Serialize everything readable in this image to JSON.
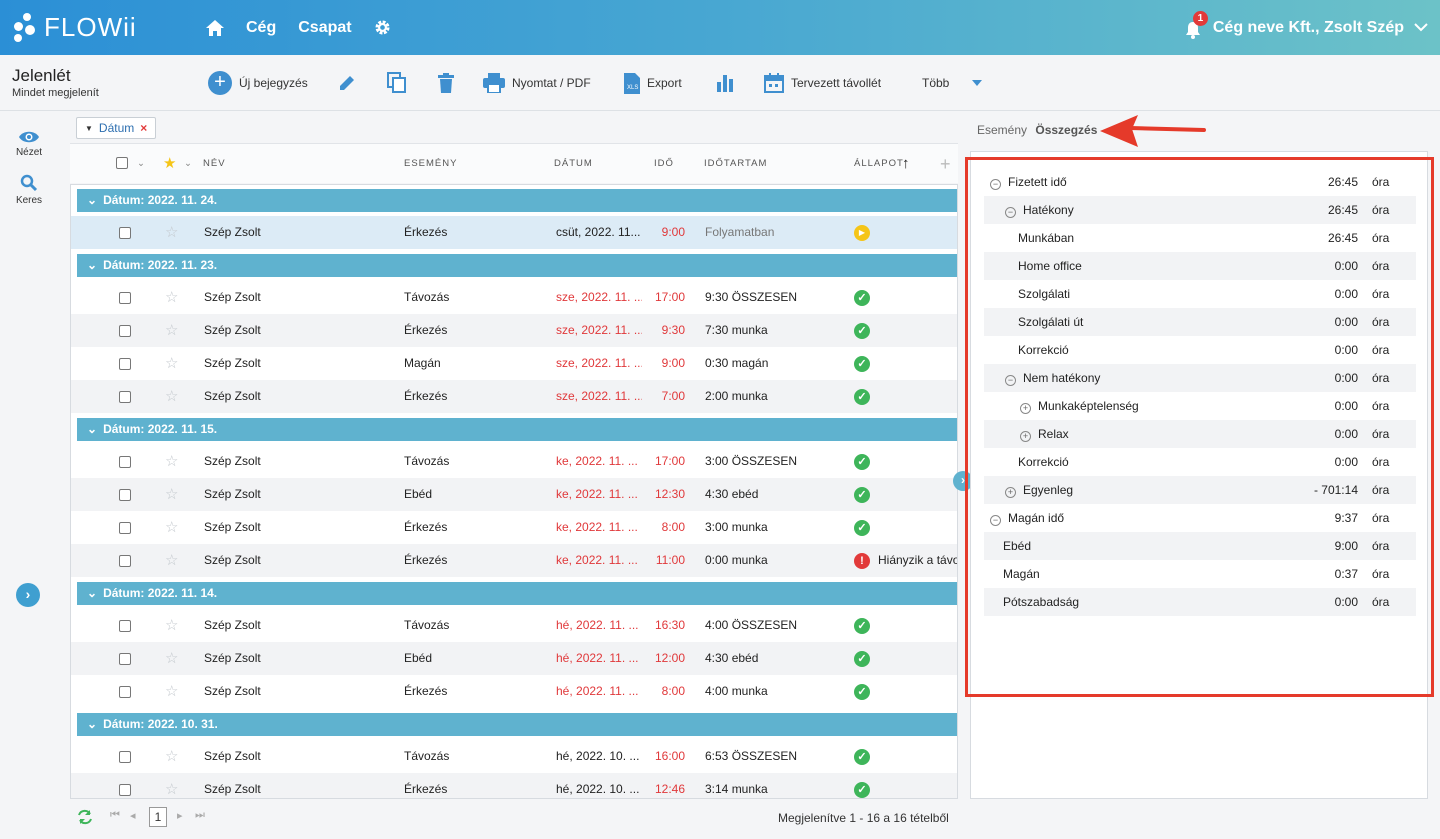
{
  "app": {
    "brand": "FLOWii",
    "nav": [
      "Cég",
      "Csapat"
    ],
    "notifications": "1",
    "account": "Cég neve Kft., Zsolt Szép"
  },
  "page": {
    "title": "Jelenlét",
    "subtitle": "Mindet megjelenít"
  },
  "toolbar": {
    "new_entry": "Új bejegyzés",
    "print": "Nyomtat / PDF",
    "export": "Export",
    "planned_absence": "Tervezett távollét",
    "more": "Több"
  },
  "sidebar": {
    "view": "Nézet",
    "search": "Keres"
  },
  "filter": {
    "chip": "Dátum"
  },
  "grid": {
    "columns": [
      "NÉV",
      "ESEMÉNY",
      "DÁTUM",
      "IDŐ",
      "IDŐTARTAM",
      "ÁLLAPOT"
    ],
    "groups": [
      {
        "label": "Dátum: 2022. 11. 24.",
        "rows": [
          {
            "name": "Szép Zsolt",
            "event": "Érkezés",
            "date": "csüt, 2022. 11...",
            "time": "9:00",
            "duration": "Folyamatban",
            "status": "in-progress",
            "date_red": false,
            "selected": true
          }
        ]
      },
      {
        "label": "Dátum: 2022. 11. 23.",
        "rows": [
          {
            "name": "Szép Zsolt",
            "event": "Távozás",
            "date": "sze, 2022. 11. ...",
            "time": "17:00",
            "duration": "9:30 ÖSSZESEN",
            "status": "ok",
            "date_red": true
          },
          {
            "name": "Szép Zsolt",
            "event": "Érkezés",
            "date": "sze, 2022. 11. ...",
            "time": "9:30",
            "duration": "7:30 munka",
            "status": "ok",
            "date_red": true
          },
          {
            "name": "Szép Zsolt",
            "event": "Magán",
            "date": "sze, 2022. 11. ...",
            "time": "9:00",
            "duration": "0:30 magán",
            "status": "ok",
            "date_red": true
          },
          {
            "name": "Szép Zsolt",
            "event": "Érkezés",
            "date": "sze, 2022. 11. ...",
            "time": "7:00",
            "duration": "2:00 munka",
            "status": "ok",
            "date_red": true
          }
        ]
      },
      {
        "label": "Dátum: 2022. 11. 15.",
        "rows": [
          {
            "name": "Szép Zsolt",
            "event": "Távozás",
            "date": "ke, 2022. 11. ...",
            "time": "17:00",
            "duration": "3:00 ÖSSZESEN",
            "status": "ok",
            "date_red": true
          },
          {
            "name": "Szép Zsolt",
            "event": "Ebéd",
            "date": "ke, 2022. 11. ...",
            "time": "12:30",
            "duration": "4:30 ebéd",
            "status": "ok",
            "date_red": true
          },
          {
            "name": "Szép Zsolt",
            "event": "Érkezés",
            "date": "ke, 2022. 11. ...",
            "time": "8:00",
            "duration": "3:00 munka",
            "status": "ok",
            "date_red": true
          },
          {
            "name": "Szép Zsolt",
            "event": "Érkezés",
            "date": "ke, 2022. 11. ...",
            "time": "11:00",
            "duration": "0:00 munka",
            "status": "error",
            "status_text": "Hiányzik a távo",
            "date_red": true
          }
        ]
      },
      {
        "label": "Dátum: 2022. 11. 14.",
        "rows": [
          {
            "name": "Szép Zsolt",
            "event": "Távozás",
            "date": "hé, 2022. 11. ...",
            "time": "16:30",
            "duration": "4:00 ÖSSZESEN",
            "status": "ok",
            "date_red": true
          },
          {
            "name": "Szép Zsolt",
            "event": "Ebéd",
            "date": "hé, 2022. 11. ...",
            "time": "12:00",
            "duration": "4:30 ebéd",
            "status": "ok",
            "date_red": true
          },
          {
            "name": "Szép Zsolt",
            "event": "Érkezés",
            "date": "hé, 2022. 11. ...",
            "time": "8:00",
            "duration": "4:00 munka",
            "status": "ok",
            "date_red": true
          }
        ]
      },
      {
        "label": "Dátum: 2022. 10. 31.",
        "rows": [
          {
            "name": "Szép Zsolt",
            "event": "Távozás",
            "date": "hé, 2022. 10. ...",
            "time": "16:00",
            "duration": "6:53 ÖSSZESEN",
            "status": "ok",
            "date_red": false
          },
          {
            "name": "Szép Zsolt",
            "event": "Érkezés",
            "date": "hé, 2022. 10. ...",
            "time": "12:46",
            "duration": "3:14 munka",
            "status": "ok",
            "date_red": false
          }
        ]
      }
    ]
  },
  "pager": {
    "page": "1",
    "summary": "Megjelenítve 1 - 16 a 16 tételből"
  },
  "right_panel": {
    "tabs": [
      "Esemény",
      "Összegzés"
    ],
    "active_tab": "Összegzés",
    "unit": "óra",
    "rows": [
      {
        "label": "Fizetett idő",
        "value": "26:45",
        "indent": 0,
        "toggle": "minus"
      },
      {
        "label": "Hatékony",
        "value": "26:45",
        "indent": 1,
        "toggle": "minus"
      },
      {
        "label": "Munkában",
        "value": "26:45",
        "indent": 2,
        "toggle": ""
      },
      {
        "label": "Home office",
        "value": "0:00",
        "indent": 2,
        "toggle": ""
      },
      {
        "label": "Szolgálati",
        "value": "0:00",
        "indent": 2,
        "toggle": ""
      },
      {
        "label": "Szolgálati út",
        "value": "0:00",
        "indent": 2,
        "toggle": ""
      },
      {
        "label": "Korrekció",
        "value": "0:00",
        "indent": 2,
        "toggle": ""
      },
      {
        "label": "Nem hatékony",
        "value": "0:00",
        "indent": 1,
        "toggle": "minus"
      },
      {
        "label": "Munkaképtelenség",
        "value": "0:00",
        "indent": 2,
        "toggle": "plus"
      },
      {
        "label": "Relax",
        "value": "0:00",
        "indent": 2,
        "toggle": "plus"
      },
      {
        "label": "Korrekció",
        "value": "0:00",
        "indent": 2,
        "toggle": ""
      },
      {
        "label": "Egyenleg",
        "value": "- 701:14",
        "indent": 1,
        "toggle": "plus"
      },
      {
        "label": "Magán idő",
        "value": "9:37",
        "indent": 0,
        "toggle": "minus"
      },
      {
        "label": "Ebéd",
        "value": "9:00",
        "indent": 1,
        "toggle": ""
      },
      {
        "label": "Magán",
        "value": "0:37",
        "indent": 1,
        "toggle": ""
      },
      {
        "label": "Pótszabadság",
        "value": "0:00",
        "indent": 1,
        "toggle": ""
      }
    ]
  },
  "colors": {
    "accent": "#3f8fcf",
    "group_header": "#5fb2cf",
    "highlight": "#e53a2a",
    "ok": "#3eb55a",
    "error": "#e23a3a"
  }
}
